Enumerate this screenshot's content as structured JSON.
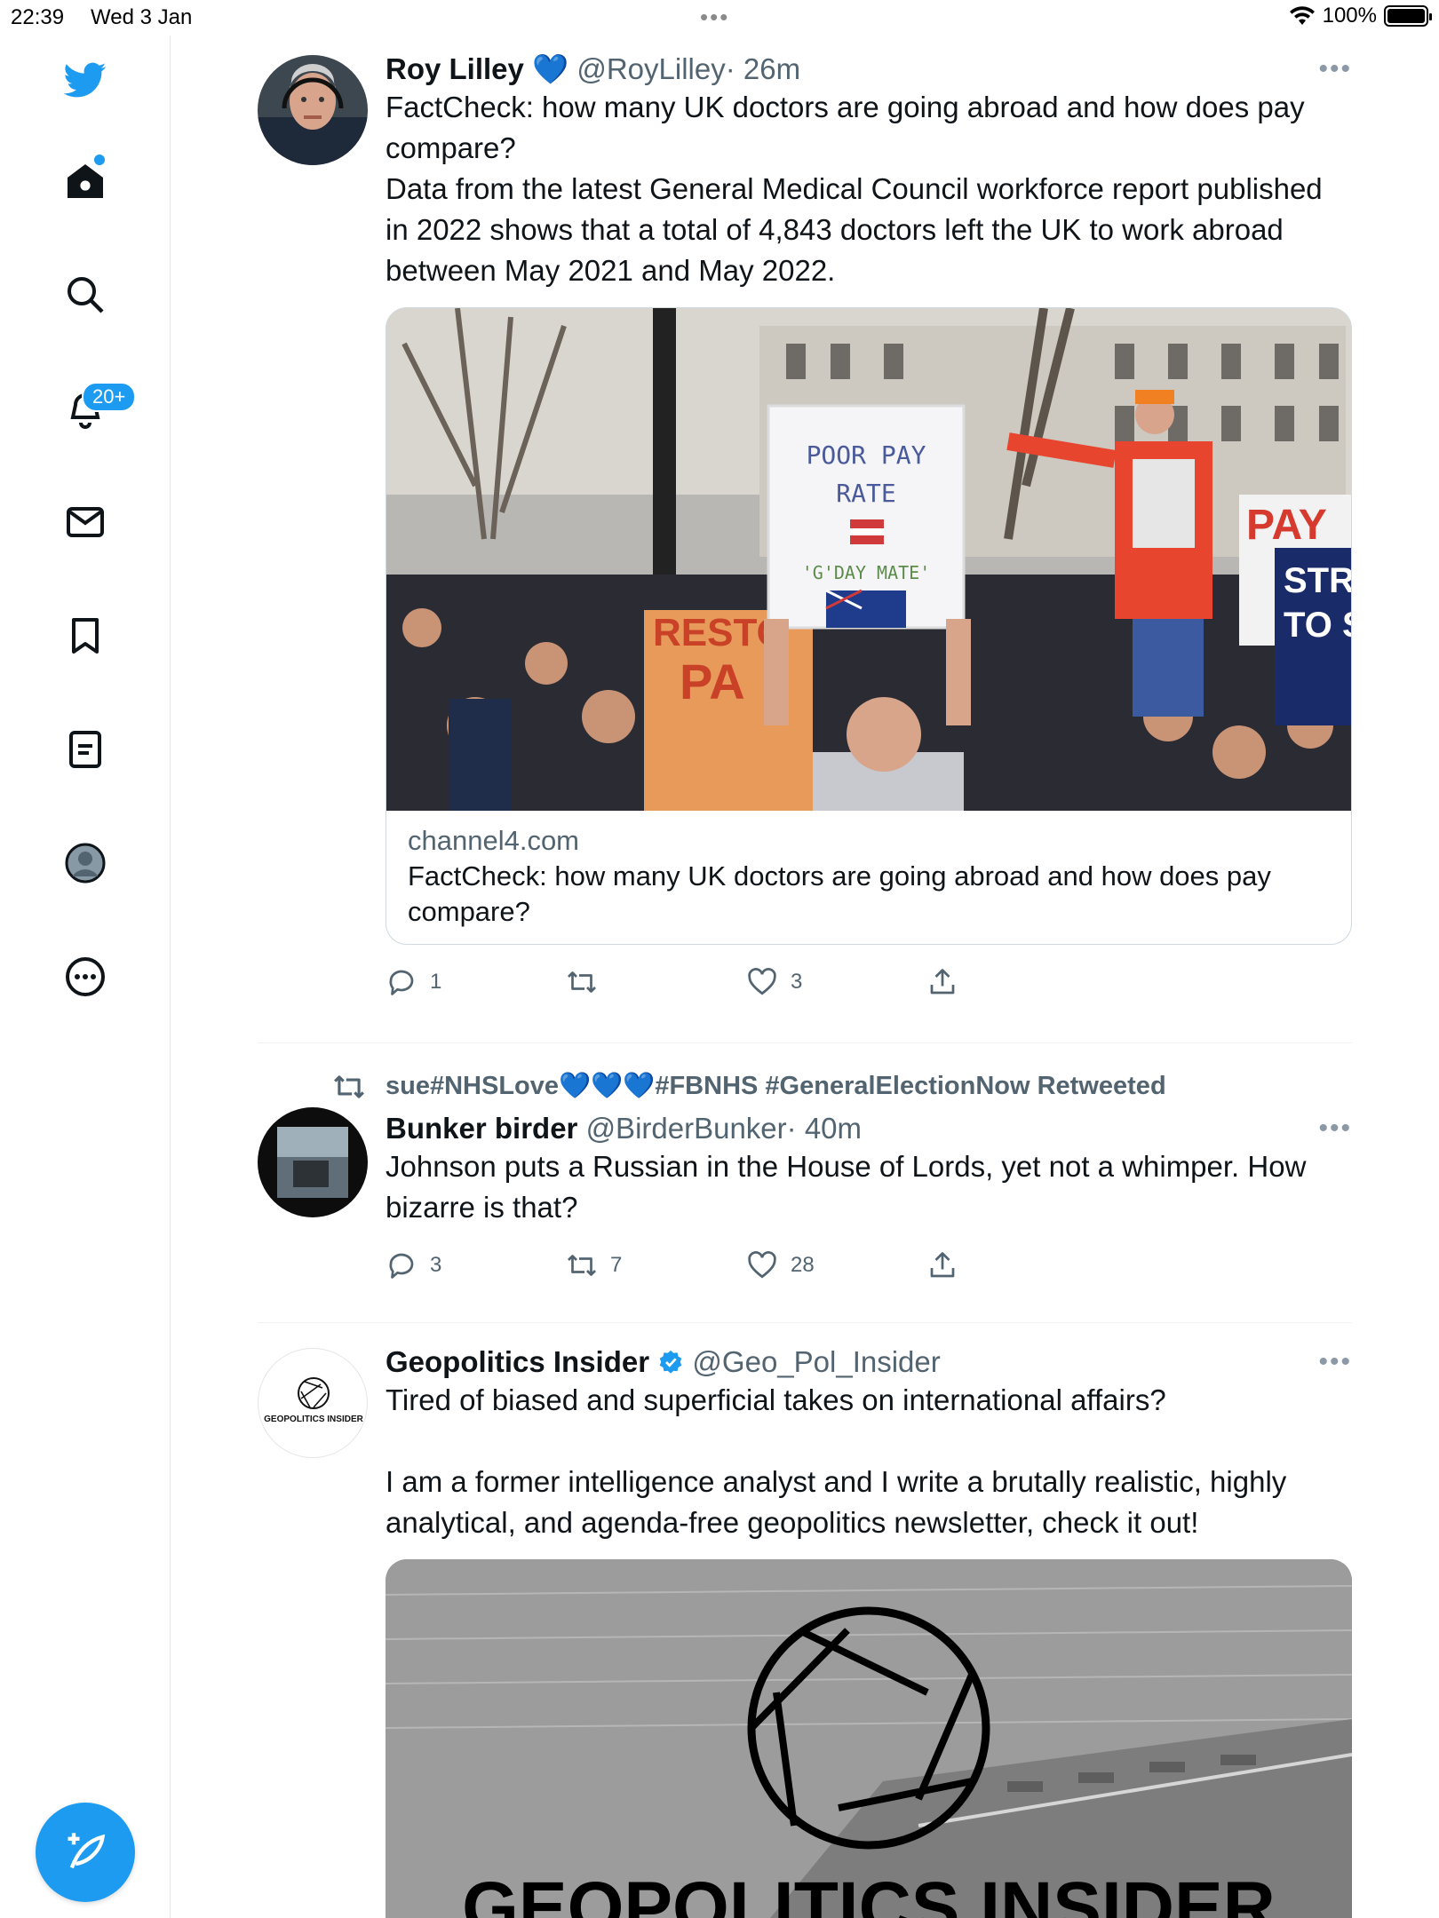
{
  "status_bar": {
    "time": "22:39",
    "date": "Wed 3 Jan",
    "battery": "100%"
  },
  "sidebar": {
    "notifications_badge": "20+",
    "items": [
      "twitter-logo",
      "home-icon",
      "search-icon",
      "notifications-icon",
      "messages-icon",
      "bookmarks-icon",
      "lists-icon",
      "profile-icon",
      "more-icon"
    ]
  },
  "tweets": [
    {
      "name": "Roy Lilley",
      "emoji": "💙",
      "handle": "@RoyLilley",
      "time": "· 26m",
      "text": "FactCheck: how many UK doctors are going abroad and how does pay compare?\nData from the latest General Medical Council workforce report published in 2022 shows that a total of 4,843 doctors left the UK to work abroad between May 2021 and May 2022.",
      "card": {
        "sign_line1": "POOR PAY",
        "sign_line2": "RATE",
        "sign_line3": "'G'DAY MATE'",
        "domain": "channel4.com",
        "title": "FactCheck: how many UK doctors are going abroad and how does pay compare?"
      },
      "replies": "1",
      "retweets": "",
      "likes": "3"
    },
    {
      "retweeted_by": "sue#NHSLove💙💙💙#FBNHS #GeneralElectionNow Retweeted",
      "name": "Bunker birder",
      "handle": "@BirderBunker",
      "time": "· 40m",
      "text": "Johnson puts a Russian in the House of Lords, yet not a whimper. How bizarre is that?",
      "replies": "3",
      "retweets": "7",
      "likes": "28"
    },
    {
      "name": "Geopolitics Insider",
      "handle": "@Geo_Pol_Insider",
      "avatar_text": "GEOPOLITICS INSIDER",
      "text": "Tired of biased and superficial takes on international affairs?\n\nI am a former intelligence analyst and I write a brutally realistic, highly analytical, and agenda-free geopolitics newsletter, check it out!",
      "image_text": "GEOPOLITICS INSIDER"
    }
  ],
  "colors": {
    "accent": "#1d9bf0",
    "text": "#0f1419",
    "secondary": "#536471",
    "border": "#cfd9de"
  }
}
